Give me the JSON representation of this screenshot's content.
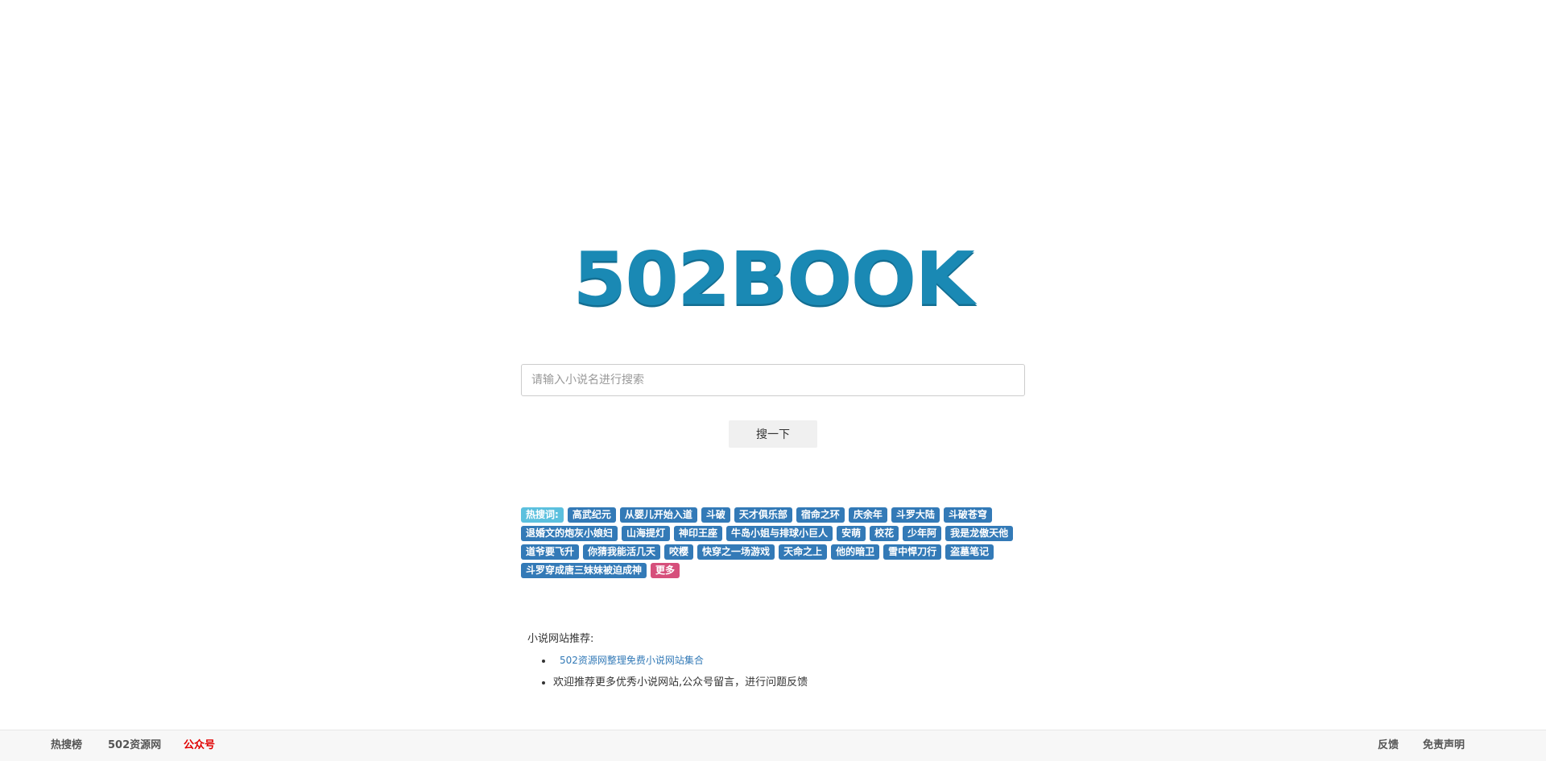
{
  "logo": {
    "text": "502BOOK"
  },
  "search": {
    "placeholder": "请输入小说名进行搜索",
    "button_label": "搜一下"
  },
  "hotwords": {
    "label": "热搜词:",
    "items": [
      "高武纪元",
      "从婴儿开始入道",
      "斗破",
      "天才俱乐部",
      "宿命之环",
      "庆余年",
      "斗罗大陆",
      "斗破苍穹",
      "退婚文的炮灰小娘妇",
      "山海提灯",
      "神印王座",
      "牛岛小姐与排球小巨人",
      "安萌",
      "校花",
      "少年阿",
      "我是龙傲天他",
      "道爷要飞升",
      "你猜我能活几天",
      "咬樱",
      "快穿之一场游戏",
      "天命之上",
      "他的暗卫",
      "雪中悍刀行",
      "盗墓笔记",
      "斗罗穿成唐三妹妹被迫成神"
    ],
    "more_label": "更多"
  },
  "recommend": {
    "title": "小说网站推荐:",
    "link_text": "502资源网整理免费小说网站集合",
    "note": "欢迎推荐更多优秀小说网站,公众号留言，进行问题反馈"
  },
  "footer": {
    "left": [
      "热搜榜",
      "502资源网",
      "公众号"
    ],
    "right": [
      "反馈",
      "免责声明"
    ]
  },
  "colors": {
    "brand": "#1a89b4",
    "tag": "#337ab7",
    "label_tag": "#5bc0de",
    "more_tag": "#d64f7b",
    "footer_highlight": "#e00000"
  }
}
